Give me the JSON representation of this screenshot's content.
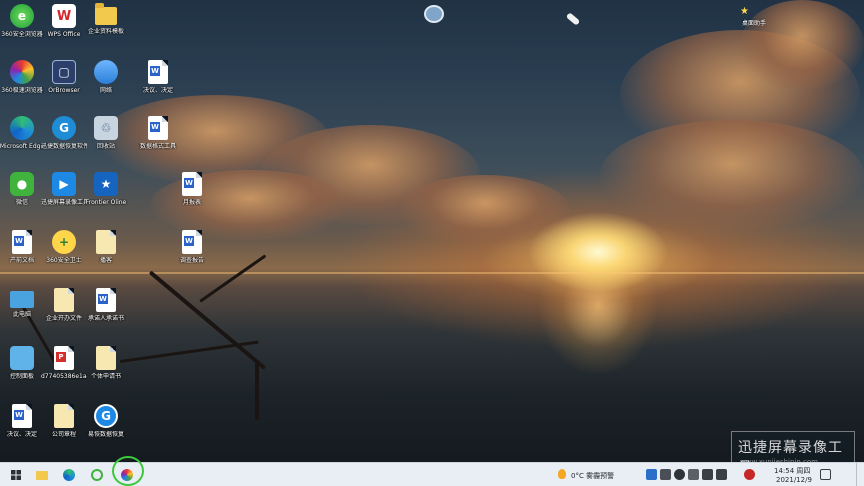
{
  "desktop_icons": [
    {
      "label": "360安全浏览器",
      "kind": "360browser",
      "col": 0,
      "row": 0
    },
    {
      "label": "WPS Office",
      "kind": "wps",
      "col": 1,
      "row": 0
    },
    {
      "label": "企业资料模板",
      "kind": "folder",
      "col": 2,
      "row": 0
    },
    {
      "label": "360极速浏览器",
      "kind": "360speed",
      "col": 0,
      "row": 1
    },
    {
      "label": "OrBrowser",
      "kind": "orbrowser",
      "col": 1,
      "row": 1
    },
    {
      "label": "网络",
      "kind": "network",
      "col": 2,
      "row": 1
    },
    {
      "label": "决议、决定",
      "kind": "doc",
      "col": 3,
      "row": 1
    },
    {
      "label": "Microsoft Edge",
      "kind": "edge",
      "col": 0,
      "row": 2
    },
    {
      "label": "迅捷数据恢复软件",
      "kind": "recovery",
      "col": 1,
      "row": 2
    },
    {
      "label": "回收站",
      "kind": "recycle",
      "col": 2,
      "row": 2
    },
    {
      "label": "数据格式工具",
      "kind": "doc",
      "col": 3,
      "row": 2
    },
    {
      "label": "微信",
      "kind": "wechat",
      "col": 0,
      "row": 3
    },
    {
      "label": "迅捷屏幕录像工具",
      "kind": "recorder",
      "col": 1,
      "row": 3
    },
    {
      "label": "Frontier Oline",
      "kind": "frontier",
      "col": 2,
      "row": 3
    },
    {
      "label": "月报表",
      "kind": "doc",
      "col": 4,
      "row": 3
    },
    {
      "label": "产前文档",
      "kind": "doc",
      "col": 0,
      "row": 4
    },
    {
      "label": "360安全卫士",
      "kind": "360safe",
      "col": 1,
      "row": 4
    },
    {
      "label": "播客",
      "kind": "docyellow",
      "col": 2,
      "row": 4
    },
    {
      "label": "调查报告",
      "kind": "doc",
      "col": 4,
      "row": 4
    },
    {
      "label": "此电脑",
      "kind": "pc",
      "col": 0,
      "row": 5
    },
    {
      "label": "企业开办文件",
      "kind": "docyellow",
      "col": 1,
      "row": 5
    },
    {
      "label": "承诺人承诺书",
      "kind": "doc",
      "col": 2,
      "row": 5
    },
    {
      "label": "控制面板",
      "kind": "control",
      "col": 0,
      "row": 6
    },
    {
      "label": "d77405386e1a42189cc...",
      "kind": "pdf",
      "col": 1,
      "row": 6
    },
    {
      "label": "个体申请书",
      "kind": "docyellow",
      "col": 2,
      "row": 6
    },
    {
      "label": "决议、决定",
      "kind": "doc",
      "col": 0,
      "row": 7
    },
    {
      "label": "公司章程",
      "kind": "docyellow",
      "col": 1,
      "row": 7
    },
    {
      "label": "易恢数据恢复",
      "kind": "easyrecover",
      "col": 2,
      "row": 7
    }
  ],
  "top_widget": {
    "label": "桌面助手"
  },
  "taskbar": {
    "weather": "0°C 雾霾预警",
    "time": "14:54 周四",
    "date": "2021/12/9"
  },
  "watermark": {
    "title": "迅捷屏幕录像工具",
    "url": "www.xunjieshipin.com"
  },
  "colors": {
    "taskbar_bg": "#e9eef4",
    "wps_red": "#d7262b",
    "edge_blue": "#1f8dd6",
    "wechat_green": "#3fb33c",
    "highlight_ring": "#3cc83c"
  }
}
